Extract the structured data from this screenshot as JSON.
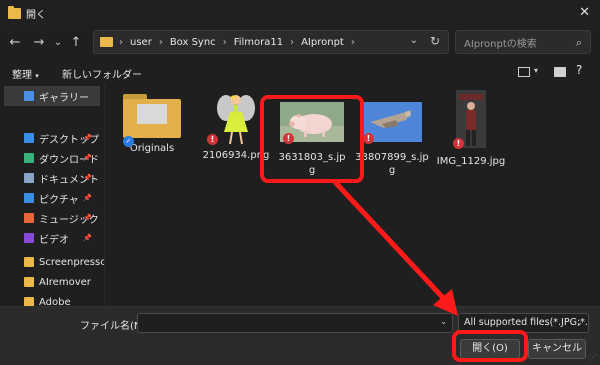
{
  "window": {
    "title": "開く",
    "close_icon": "✕"
  },
  "nav": {
    "back": "←",
    "forward": "→",
    "dropdown": "⌄",
    "up": "↑",
    "breadcrumb": [
      "user",
      "Box Sync",
      "Filmora11",
      "AIpronpt"
    ],
    "search_placeholder": "AIpronptの検索"
  },
  "toolbar": {
    "organize": "整理",
    "new_folder": "新しいフォルダー"
  },
  "sidebar": {
    "items": [
      {
        "label": "ギャラリー",
        "color": "#4a90e2",
        "pinned": false
      },
      {
        "label": "デスクトップ",
        "color": "#3a8ee6",
        "pinned": true
      },
      {
        "label": "ダウンロード",
        "color": "#3ab07a",
        "pinned": true
      },
      {
        "label": "ドキュメント",
        "color": "#8aa4c8",
        "pinned": true
      },
      {
        "label": "ピクチャ",
        "color": "#3b8ee0",
        "pinned": true
      },
      {
        "label": "ミュージック",
        "color": "#e8643a",
        "pinned": true
      },
      {
        "label": "ビデオ",
        "color": "#8a4ad8",
        "pinned": true
      },
      {
        "label": "Screenpressc",
        "color": "#e9b94a",
        "pinned": false
      },
      {
        "label": "AIremover",
        "color": "#e9b94a",
        "pinned": false
      },
      {
        "label": "Adobe",
        "color": "#e9b94a",
        "pinned": false
      }
    ]
  },
  "files": [
    {
      "name": "Originals",
      "kind": "folder",
      "status": "sync"
    },
    {
      "name": "2106934.png",
      "kind": "fairy",
      "status": "error"
    },
    {
      "name": "3631803_s.jpg",
      "line1": "3631803_s.jp",
      "line2": "g",
      "kind": "pig",
      "status": "error"
    },
    {
      "name": "33807899_s.jpg",
      "line1": "33807899_s.jp",
      "line2": "g",
      "kind": "bird",
      "status": "error"
    },
    {
      "name": "IMG_1129.jpg",
      "kind": "person",
      "status": "error"
    }
  ],
  "bottom": {
    "filename_label": "ファイル名(N):",
    "filename_value": "",
    "filetype": "All supported files(*.JPG;*.",
    "open_button": "開く(O)",
    "cancel_button": "キャンセル"
  },
  "colors": {
    "highlight": "#ff1a1a",
    "error": "#d13438",
    "sync": "#2a7ae2"
  }
}
